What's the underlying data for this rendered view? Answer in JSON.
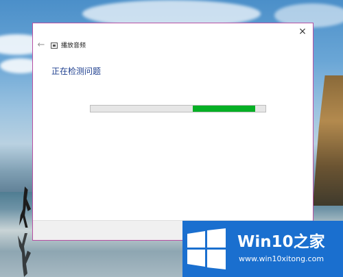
{
  "window": {
    "close_label": "×",
    "back_label": "←",
    "title": "播放音频",
    "heading": "正在检测问题",
    "progress": {
      "bar_start_percent": 58.5,
      "bar_end_percent": 94,
      "fill_color": "#06b025",
      "mode": "indeterminate"
    }
  },
  "watermark": {
    "brand": "Win10之家",
    "url": "www.win10xitong.com",
    "color": "#1a6fcf"
  },
  "icons": {
    "back": "arrow-left-icon",
    "app": "troubleshooter-icon",
    "close": "close-icon",
    "logo": "windows-logo-icon"
  }
}
